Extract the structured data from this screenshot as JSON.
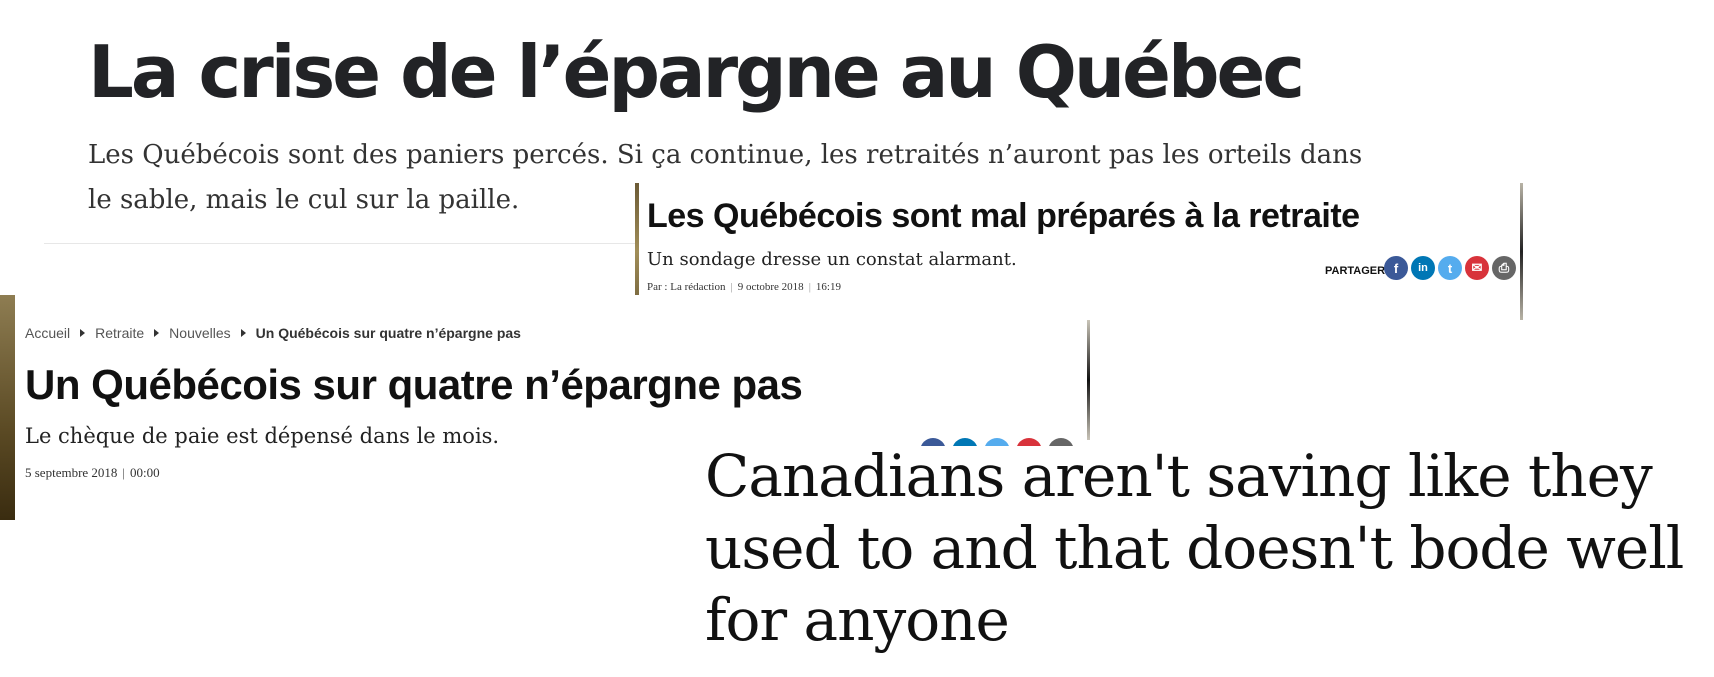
{
  "clip1": {
    "title": "La crise de l’épargne au Québec",
    "dek": "Les Québécois sont des paniers percés. Si ça continue, les retraités n’auront pas les orteils dans le sable, mais le cul sur la paille."
  },
  "clip2": {
    "title": "Les Québécois sont mal préparés à la retraite",
    "dek": "Un sondage dresse un constat alarmant.",
    "byline": "Par : La rédaction",
    "separator": "|",
    "date": "9 octobre 2018",
    "time": "16:19",
    "share_label": "PARTAGER",
    "share_icons": [
      {
        "name": "facebook-icon",
        "glyph": "f",
        "color": "#3b5998"
      },
      {
        "name": "linkedin-icon",
        "glyph": "in",
        "color": "#0077b5"
      },
      {
        "name": "twitter-icon",
        "glyph": "t",
        "color": "#55acee"
      },
      {
        "name": "email-icon",
        "glyph": "✉",
        "color": "#d8333b"
      },
      {
        "name": "print-icon",
        "glyph": "⎙",
        "color": "#666666"
      }
    ]
  },
  "clip3": {
    "breadcrumb": {
      "home": "Accueil",
      "section": "Retraite",
      "subsection": "Nouvelles",
      "current": "Un Québécois sur quatre n’épargne pas"
    },
    "title": "Un Québécois sur quatre n’épargne pas",
    "dek": "Le chèque de paie est dépensé dans le mois.",
    "date": "5 septembre 2018",
    "separator": "|",
    "time": "00:00"
  },
  "clip4": {
    "title": "Canadians aren't saving like they used to and that doesn't bode well for anyone"
  },
  "colors": {
    "accent_yellow": "#f5b914",
    "headline": "#222326"
  }
}
